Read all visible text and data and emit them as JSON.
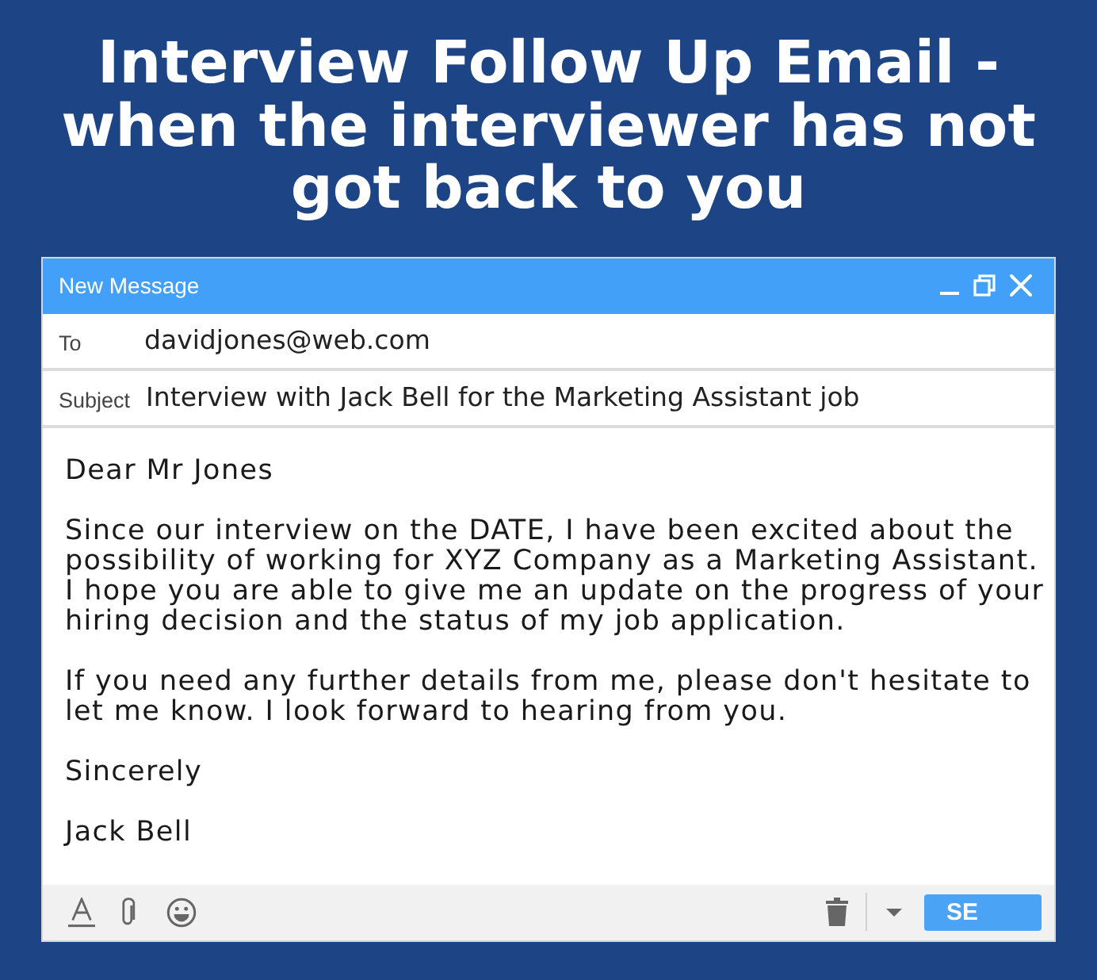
{
  "title": "Interview Follow Up Email - when the interviewer has not got back to you",
  "window": {
    "title": "New Message"
  },
  "fields": [
    {
      "label": "To",
      "value": "davidjones@web.com"
    },
    {
      "label": "Subject",
      "value": "Interview with Jack Bell for the Marketing Assistant job"
    }
  ],
  "body": {
    "paragraphs": [
      [
        "Dear Mr Jones"
      ],
      [
        "Since our interview on the DATE, I have been excited about the",
        "possibility of working for XYZ Company as a Marketing Assistant.",
        "I hope you are able to give me an update on the progress of your",
        "hiring decision and the status of my job application."
      ],
      [
        "If you need any further details from me, please don't hesitate to",
        "let me know. I look forward to hearing from you."
      ],
      [
        "Sincerely"
      ],
      [
        "Jack Bell"
      ]
    ]
  },
  "toolbar": {
    "send_button": "SE"
  }
}
